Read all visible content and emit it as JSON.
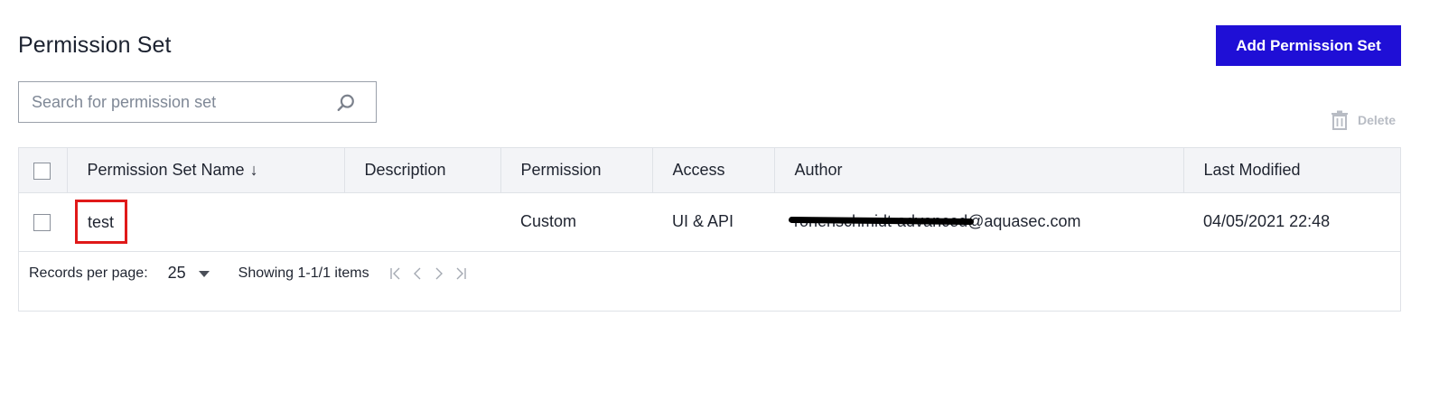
{
  "page": {
    "title": "Permission Set"
  },
  "actions": {
    "add_label": "Add Permission Set",
    "delete_label": "Delete"
  },
  "search": {
    "placeholder": "Search for permission set"
  },
  "table": {
    "columns": [
      "Permission Set Name",
      "Description",
      "Permission",
      "Access",
      "Author",
      "Last Modified"
    ],
    "sort_indicator": "↓",
    "rows": [
      {
        "name": "test",
        "description": "",
        "permission": "Custom",
        "access": "UI & API",
        "author": "ronenschmidt-advanced@aquasec.com",
        "last_modified": "04/05/2021 22:48"
      }
    ]
  },
  "pagination": {
    "records_per_page_label": "Records per page:",
    "records_per_page_value": "25",
    "showing": "Showing 1-1/1 items"
  },
  "colors": {
    "accent": "#1f0fd6",
    "highlight": "#e01919",
    "disabled": "#b8bcc4"
  },
  "icons": [
    "search-icon",
    "trash-icon",
    "sort-down-icon",
    "caret-down-icon",
    "first-page-icon",
    "prev-page-icon",
    "next-page-icon",
    "last-page-icon"
  ]
}
